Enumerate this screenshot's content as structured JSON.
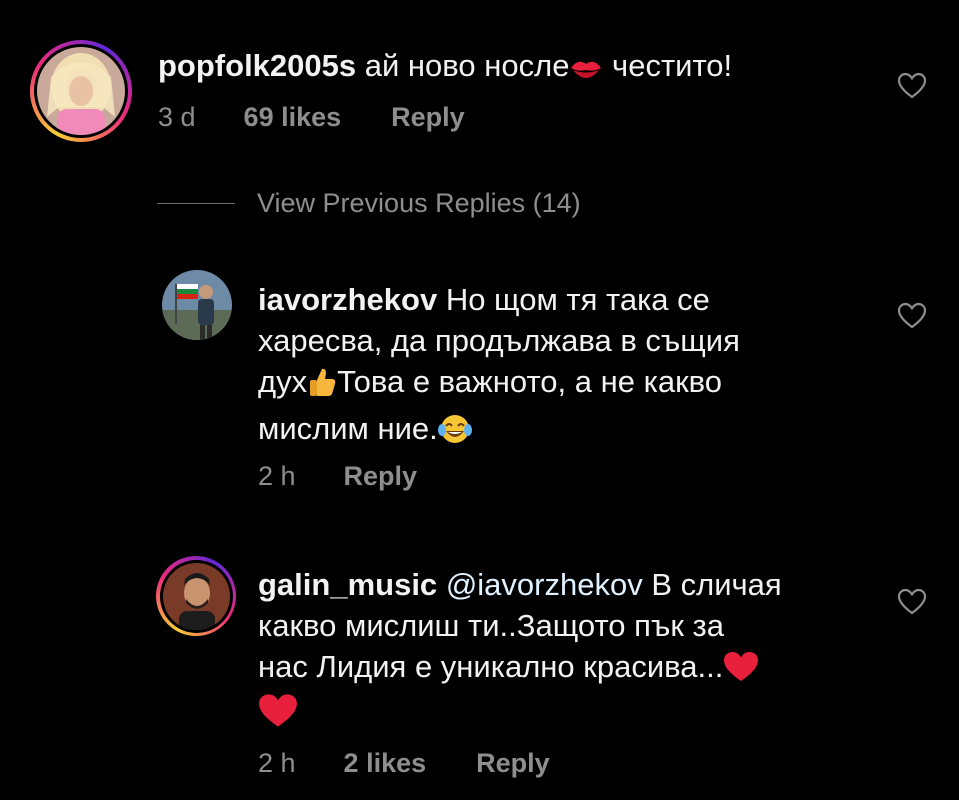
{
  "comments": [
    {
      "username": "popfolk2005s",
      "text_before": " ай ново носле",
      "emoji_inline": "lips",
      "text_after": " честито!",
      "time": "3 d",
      "likes": "69 likes",
      "reply": "Reply"
    },
    {
      "username": "iavorzhekov",
      "line1_text": " Но щом тя така се",
      "line2": "харесва, да продължава в същия",
      "line3_before": "дух",
      "line3_after": "Това е важното, а не какво",
      "line4": "мислим ние.",
      "time": "2 h",
      "reply": "Reply"
    },
    {
      "username": "galin_music",
      "mention": "@iavorzhekov",
      "line1_rest": " В сличая",
      "line2": "какво мислиш ти..Защото пък за",
      "line3": "нас Лидия е уникално красива...",
      "time": "2 h",
      "likes": "2 likes",
      "reply": "Reply"
    }
  ],
  "view_previous_replies": "View Previous Replies (14)",
  "icons": {
    "heart": "heart-outline-icon",
    "lips": "kiss-mark-icon",
    "thumbs": "thumbs-up-icon",
    "laugh": "tears-of-joy-icon",
    "red_heart": "red-heart-icon"
  },
  "colors": {
    "background": "#000000",
    "text": "#f2f2f2",
    "meta": "#8e8e8e",
    "heart_red": "#e8203b"
  }
}
